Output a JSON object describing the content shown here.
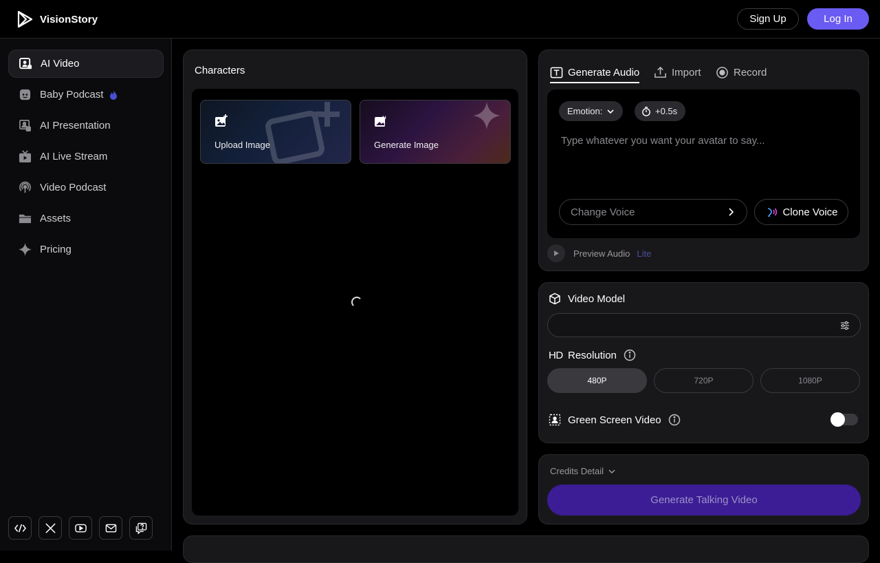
{
  "header": {
    "brand": "VisionStory",
    "signup_label": "Sign Up",
    "login_label": "Log In",
    "login_color": "#6a5bf2"
  },
  "sidebar": {
    "items": [
      {
        "label": "AI Video",
        "icon": "user-video-icon",
        "active": true
      },
      {
        "label": "Baby Podcast",
        "icon": "baby-face-icon",
        "badge_icon": "fire-icon"
      },
      {
        "label": "AI Presentation",
        "icon": "presentation-icon"
      },
      {
        "label": "AI Live Stream",
        "icon": "tv-icon"
      },
      {
        "label": "Video Podcast",
        "icon": "podcast-icon"
      },
      {
        "label": "Assets",
        "icon": "folder-icon"
      },
      {
        "label": "Pricing",
        "icon": "sparkle-icon"
      }
    ],
    "social_icons": [
      "code-icon",
      "x-icon",
      "youtube-icon",
      "mail-icon",
      "help-chat-icon"
    ]
  },
  "characters": {
    "title": "Characters",
    "upload_label": "Upload Image",
    "generate_label": "Generate Image"
  },
  "audio": {
    "tabs": [
      {
        "label": "Generate Audio",
        "icon": "text-t-icon",
        "active": true
      },
      {
        "label": "Import",
        "icon": "upload-icon"
      },
      {
        "label": "Record",
        "icon": "record-icon"
      }
    ],
    "emotion_label": "Emotion:",
    "pause_label": "+0.5s",
    "text_placeholder": "Type whatever you want your avatar to say...",
    "change_voice_placeholder": "Change Voice",
    "clone_voice_label": "Clone Voice",
    "preview_label": "Preview Audio",
    "preview_badge": "Lite"
  },
  "video_model": {
    "title": "Video Model",
    "model_value": "",
    "resolution_title": "Resolution",
    "resolution_badge": "HD",
    "resolutions": [
      "480P",
      "720P",
      "1080P"
    ],
    "selected_resolution": "480P",
    "green_screen_label": "Green Screen Video",
    "green_screen_on": false
  },
  "credits": {
    "title": "Credits Detail",
    "generate_label": "Generate Talking Video",
    "button_color": "#3c1d95"
  }
}
